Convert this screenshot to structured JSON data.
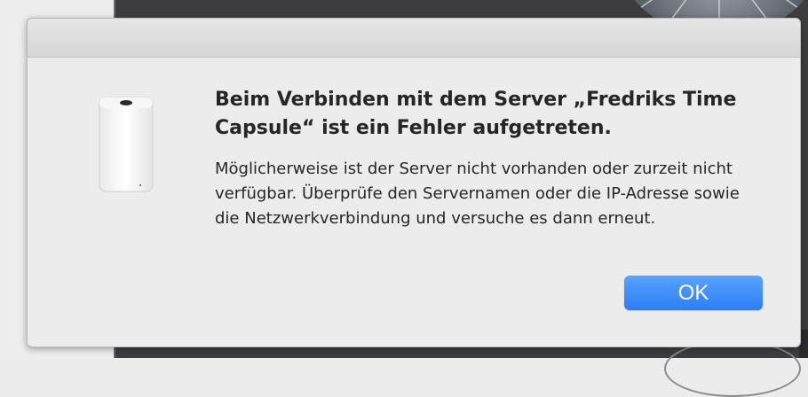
{
  "dialog": {
    "icon": "time-capsule-device-icon",
    "title": "Beim Verbinden mit dem Server „Fredriks Time Capsule“ ist ein Fehler aufgetreten.",
    "message": "Möglicherweise ist der Server nicht vorhanden oder zurzeit nicht verfügbar. Überprüfe den Servernamen oder die IP-Adresse sowie die Netzwerkverbindung und versuche es dann erneut.",
    "ok_label": "OK"
  },
  "colors": {
    "accent": "#2c7ef4",
    "dialog_bg": "#ececec",
    "desktop_bg": "#3d3d3f",
    "text": "#262626"
  }
}
